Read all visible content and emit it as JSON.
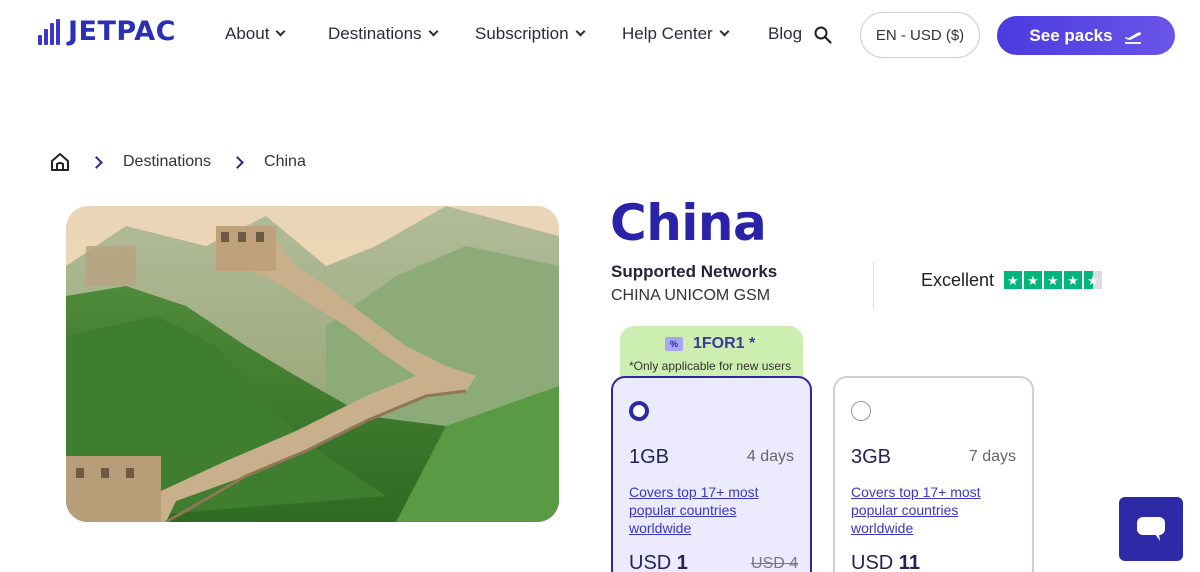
{
  "header": {
    "logo_text": "JETPAC",
    "nav": [
      {
        "label": "About",
        "has_dropdown": true
      },
      {
        "label": "Destinations",
        "has_dropdown": true
      },
      {
        "label": "Subscription",
        "has_dropdown": true
      },
      {
        "label": "Help Center",
        "has_dropdown": true
      },
      {
        "label": "Blog",
        "has_dropdown": false
      }
    ],
    "search_icon": "search-icon",
    "language_currency": "EN - USD ($)",
    "cta_label": "See packs",
    "cta_icon": "plane-takeoff-icon"
  },
  "breadcrumb": {
    "home_icon": "home-icon",
    "items": [
      "Destinations",
      "China"
    ]
  },
  "hero_image": {
    "subject": "great-wall-photo"
  },
  "country": {
    "title": "China",
    "networks_label": "Supported Networks",
    "networks_value": "CHINA UNICOM GSM",
    "rating_label": "Excellent",
    "rating_stars": 4.5
  },
  "promo": {
    "code": "1FOR1 *",
    "note": "*Only applicable for new users",
    "icon": "ticket-icon"
  },
  "plans": [
    {
      "size": "1GB",
      "days": "4 days",
      "link": "Covers top 17+ most popular countries worldwide",
      "currency": "USD",
      "price": "1",
      "old_price": "USD 4",
      "selected": true
    },
    {
      "size": "3GB",
      "days": "7 days",
      "link": "Covers top 17+ most popular countries worldwide",
      "currency": "USD",
      "price": "11",
      "old_price": "",
      "selected": false
    }
  ],
  "colors": {
    "brand": "#2a22a8",
    "cta": "#5a48e4",
    "promo_bg": "#ccefb1",
    "selected_card_bg": "#eceaff",
    "trustpilot_green": "#00b67a"
  },
  "chat": {
    "icon": "chat-bubble-icon"
  }
}
